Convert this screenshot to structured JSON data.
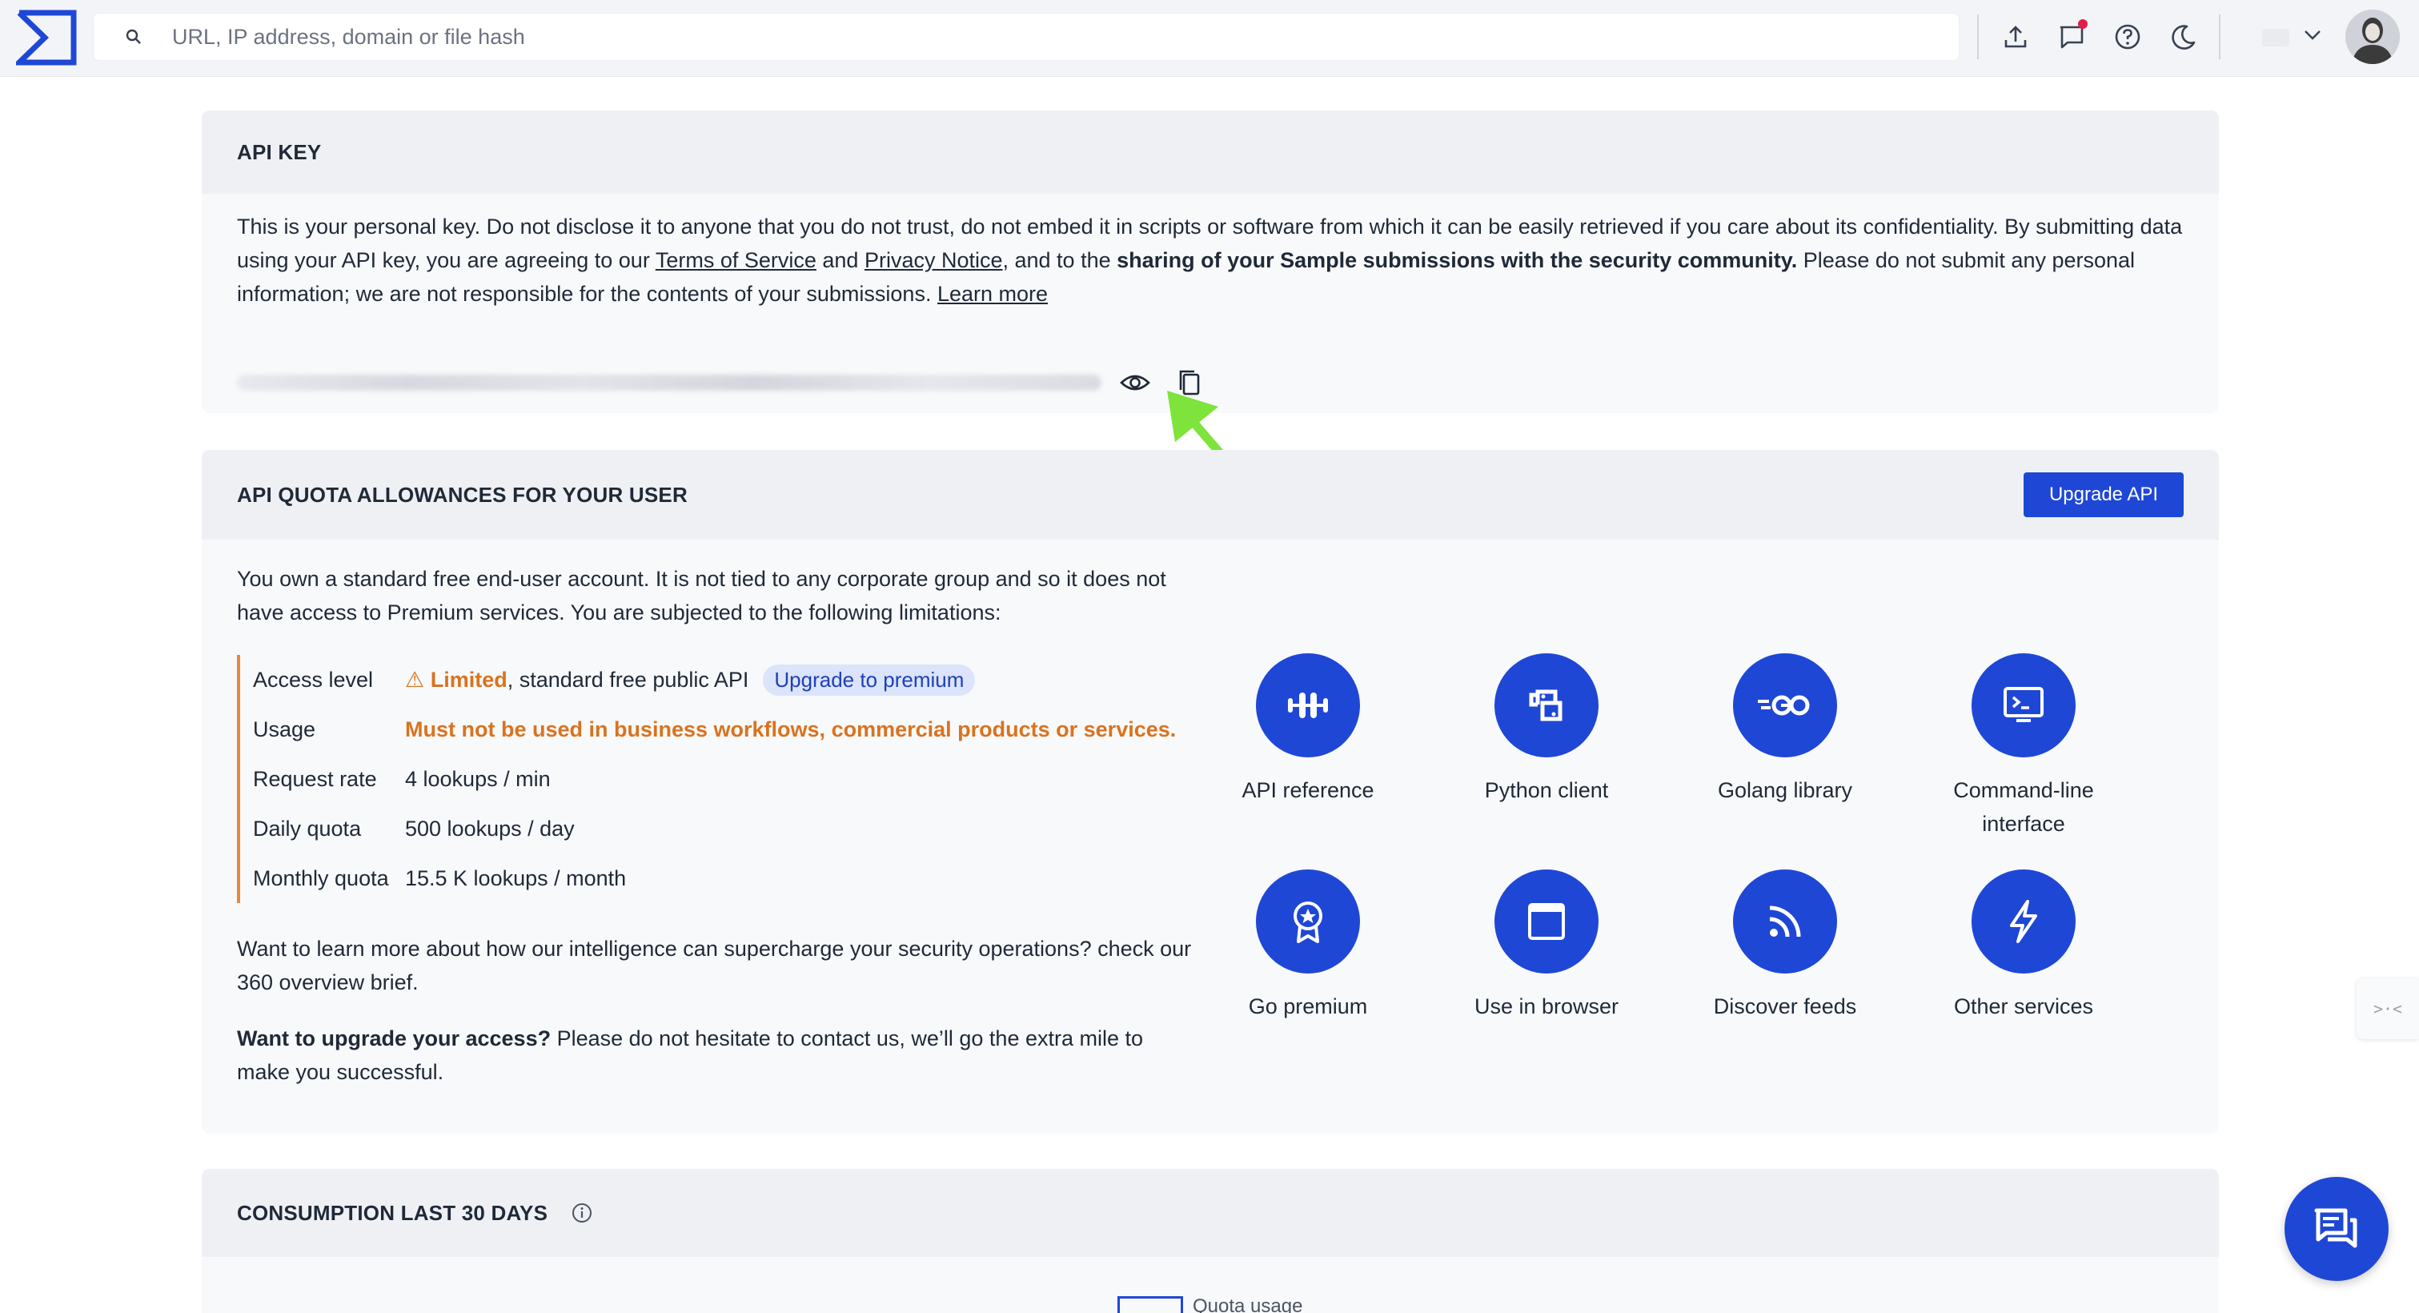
{
  "search": {
    "placeholder": "URL, IP address, domain or file hash"
  },
  "topbar": {
    "icons": [
      "upload-icon",
      "chat-notification-icon",
      "help-icon",
      "dark-mode-icon",
      "language-icon",
      "chevron-down-icon",
      "avatar"
    ]
  },
  "api_key": {
    "title": "API KEY",
    "intro_1": "This is your personal key. Do not disclose it to anyone that you do not trust, do not embed it in scripts or software from which it can be easily retrieved if you care about its confidentiality. By submitting data using your API key, you are agreeing to our ",
    "terms_link": "Terms of Service",
    "and": " and ",
    "privacy_link": "Privacy Notice",
    "intro_2": ", and to the ",
    "sharing_bold": "sharing of your Sample submissions with the security community.",
    "intro_3": " Please do not submit any personal information; we are not responsible for the contents of your submissions. ",
    "learn_more": "Learn more",
    "key_value": "1f12f1b6f1278f9a1b0ab0d0580a8b1493d2ab00e7f11b470f9f2e85b1800c61f1"
  },
  "quota": {
    "title": "API QUOTA ALLOWANCES FOR YOUR USER",
    "upgrade_button": "Upgrade API",
    "intro": "You own a standard free end-user account. It is not tied to any corporate group and so it does not have access to Premium services. You are subjected to the following limitations:",
    "rows": [
      {
        "label": "Access level",
        "warn": "⚠ Limited",
        "value": ", standard free public API",
        "badge": "Upgrade to premium"
      },
      {
        "label": "Usage",
        "value": "Must not be used in business workflows, commercial products or services."
      },
      {
        "label": "Request rate",
        "value": "4 lookups / min"
      },
      {
        "label": "Daily quota",
        "value": "500 lookups / day"
      },
      {
        "label": "Monthly quota",
        "value": "15.5 K lookups / month"
      }
    ],
    "learn_more_text": "Want to learn more about how our intelligence can supercharge your security operations? check our 360 overview brief.",
    "upgrade_bold": "Want to upgrade your access?",
    "upgrade_text": " Please do not hesitate to contact us, we’ll go the extra mile to make you successful.",
    "tools": [
      {
        "label": "API reference",
        "icon": "api-reference-icon"
      },
      {
        "label": "Python client",
        "icon": "python-icon"
      },
      {
        "label": "Golang library",
        "icon": "golang-icon"
      },
      {
        "label": "Command-line interface",
        "icon": "terminal-icon"
      },
      {
        "label": "Go premium",
        "icon": "premium-badge-icon"
      },
      {
        "label": "Use in browser",
        "icon": "browser-window-icon"
      },
      {
        "label": "Discover feeds",
        "icon": "rss-feed-icon"
      },
      {
        "label": "Other services",
        "icon": "lightning-icon"
      }
    ]
  },
  "consumption": {
    "title": "CONSUMPTION LAST 30 DAYS",
    "legend": "Quota usage"
  },
  "colors": {
    "accent": "#1f47d6",
    "warning": "#d9731f",
    "arrow": "#7ee33b"
  }
}
